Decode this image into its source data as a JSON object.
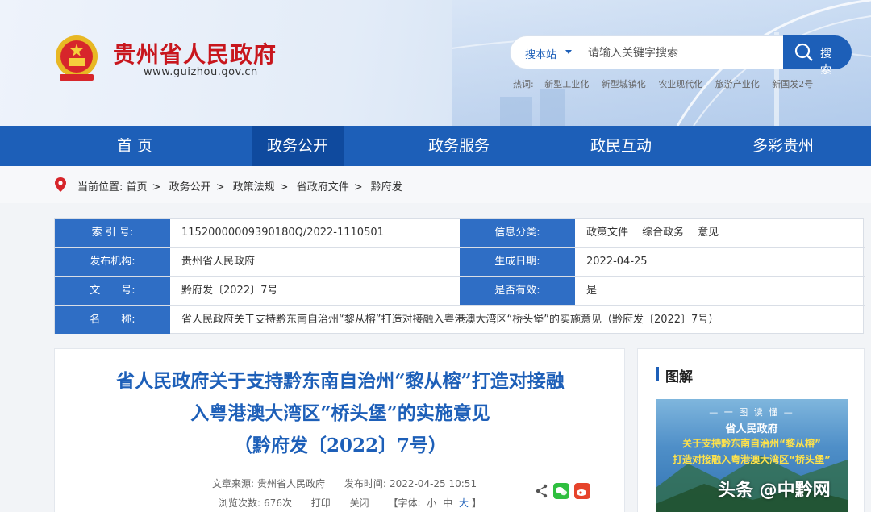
{
  "header": {
    "site_name": "贵州省人民政府",
    "site_url": "www.guizhou.gov.cn",
    "search_scope": "搜本站",
    "search_placeholder": "请输入关键字搜索",
    "search_button": "搜 索",
    "hot_label": "热词:",
    "hot_words": [
      "新型工业化",
      "新型城镇化",
      "农业现代化",
      "旅游产业化",
      "新国发2号"
    ]
  },
  "nav": {
    "items": [
      "首 页",
      "政务公开",
      "政务服务",
      "政民互动",
      "多彩贵州"
    ],
    "active_index": 1
  },
  "breadcrumb": {
    "label": "当前位置:",
    "items": [
      "首页",
      "政务公开",
      "政策法规",
      "省政府文件",
      "黔府发"
    ]
  },
  "info": {
    "index_label": "索 引 号:",
    "index_value": "11520000009390180Q/2022-1110501",
    "category_label": "信息分类:",
    "category_value": "政策文件　 综合政务　 意见",
    "publisher_label": "发布机构:",
    "publisher_value": "贵州省人民政府",
    "date_label": "生成日期:",
    "date_value": "2022-04-25",
    "docno_label": "文　　号:",
    "docno_value": "黔府发〔2022〕7号",
    "valid_label": "是否有效:",
    "valid_value": "是",
    "name_label": "名　　称:",
    "name_value": "省人民政府关于支持黔东南自治州“黎从榕”打造对接融入粤港澳大湾区“桥头堡”的实施意见（黔府发〔2022〕7号）"
  },
  "article": {
    "title_line1": "省人民政府关于支持黔东南自治州“黎从榕”打造对接融",
    "title_line2": "入粤港澳大湾区“桥头堡”的实施意见",
    "title_line3": "（黔府发〔2022〕7号）",
    "source_label": "文章来源:",
    "source_value": "贵州省人民政府",
    "time_label": "发布时间:",
    "time_value": "2022-04-25 10:51",
    "views_label": "浏览次数:",
    "views_value": "676次",
    "print": "打印",
    "close": "关闭",
    "font_label": "【字体:",
    "font_small": "小",
    "font_medium": "中",
    "font_large": "大",
    "font_end": "】"
  },
  "side": {
    "title": "图解",
    "poster_tag": "— 一 图 读 懂 —",
    "poster_line1": "省人民政府",
    "poster_line2": "关于支持黔东南自治州“黎从榕”",
    "poster_line3": "打造对接融入粤港澳大湾区“桥头堡”"
  },
  "watermark": "头条 @中黔网",
  "colors": {
    "brand_blue": "#1d5fb8",
    "brand_red": "#c8161d",
    "nav_active": "#0f4a9e"
  }
}
